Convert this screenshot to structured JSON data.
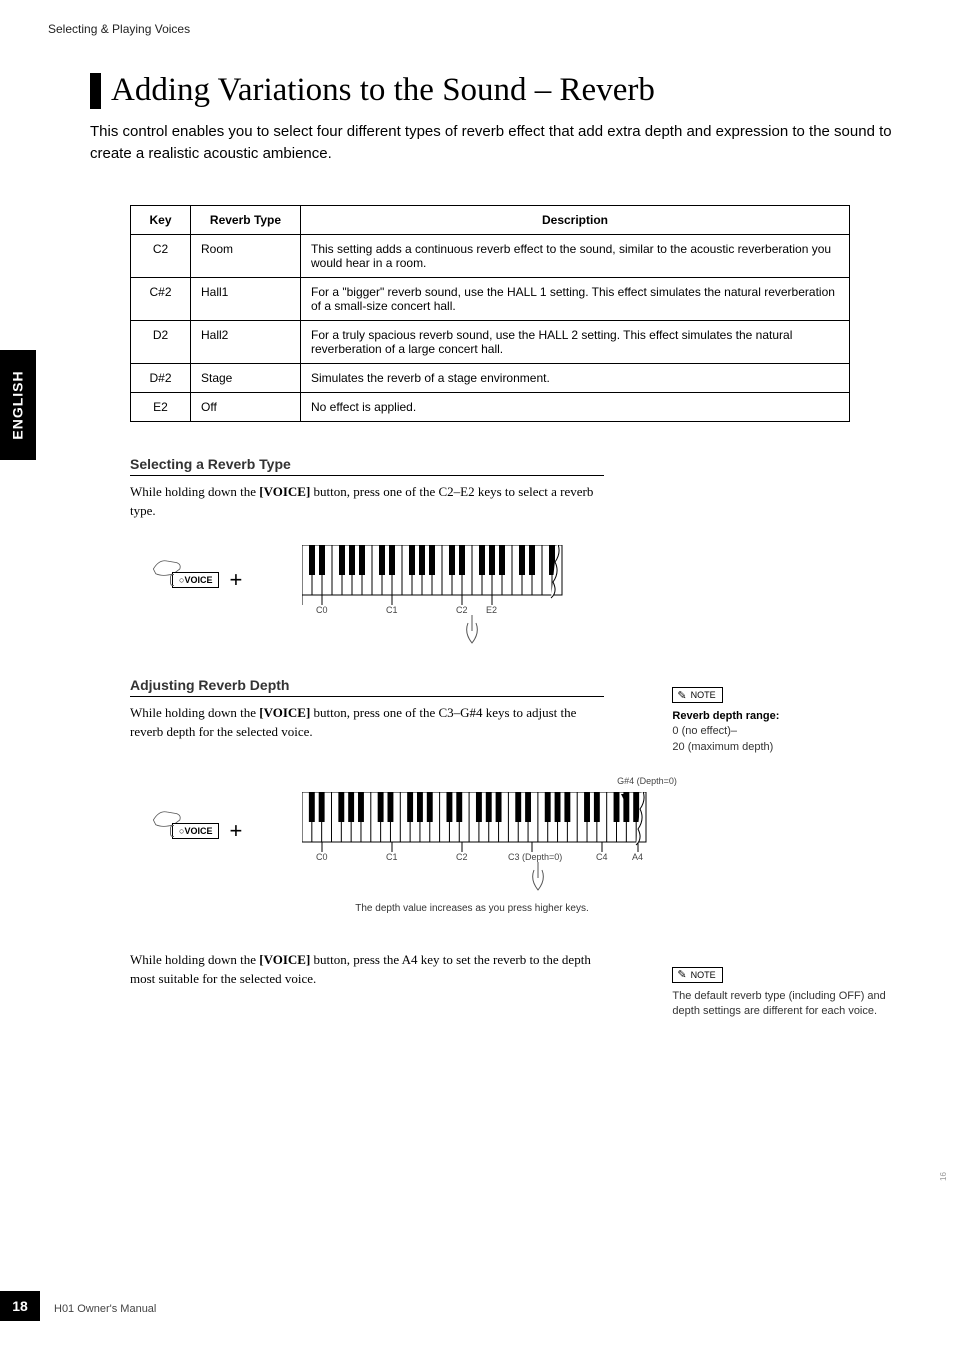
{
  "breadcrumb": "Selecting & Playing Voices",
  "sideTab": "ENGLISH",
  "title": "Adding Variations to the Sound – Reverb",
  "intro": "This control enables you to select four different types of reverb effect that add extra depth and expression to the sound to create a realistic acoustic ambience.",
  "table": {
    "headers": {
      "key": "Key",
      "type": "Reverb Type",
      "desc": "Description"
    },
    "rows": [
      {
        "key": "C2",
        "type": "Room",
        "desc": "This setting adds a continuous reverb effect to the sound, similar to the acoustic reverberation you would hear in a room."
      },
      {
        "key": "C#2",
        "type": "Hall1",
        "desc": "For a \"bigger\" reverb sound, use the HALL 1 setting. This effect simulates the natural reverberation of a small-size concert hall."
      },
      {
        "key": "D2",
        "type": "Hall2",
        "desc": "For a truly spacious reverb sound, use the HALL 2 setting. This effect simulates the natural reverberation of a large concert hall."
      },
      {
        "key": "D#2",
        "type": "Stage",
        "desc": "Simulates the reverb of a stage environment."
      },
      {
        "key": "E2",
        "type": "Off",
        "desc": "No effect is applied."
      }
    ]
  },
  "section1": {
    "heading": "Selecting a Reverb Type",
    "text_pre": "While holding down the ",
    "text_btn": "[VOICE]",
    "text_post": " button, press one of the C2–E2 keys to select a reverb type.",
    "voiceLabel": "VOICE",
    "plus": "+",
    "kb": {
      "c0": "C0",
      "c1": "C1",
      "c2": "C2",
      "e2": "E2"
    }
  },
  "section2": {
    "heading": "Adjusting Reverb Depth",
    "text_pre": "While holding down the ",
    "text_btn": "[VOICE]",
    "text_post": " button, press one of the C3–G#4 keys to adjust the reverb depth for the selected voice.",
    "voiceLabel": "VOICE",
    "plus": "+",
    "kb": {
      "c0": "C0",
      "c1": "C1",
      "c2": "C2",
      "c3": "C3 (Depth=0)",
      "c4": "C4",
      "a4": "A4",
      "g4": "G#4 (Depth=0)"
    },
    "caption": "The depth value increases as you press higher keys.",
    "note": {
      "label": "NOTE",
      "title": "Reverb depth range:",
      "range1": "0 (no effect)–",
      "range2": "20 (maximum depth)"
    }
  },
  "section3": {
    "text_pre": "While holding down the ",
    "text_btn": "[VOICE]",
    "text_post": " button, press the A4 key to set the reverb to the depth most suitable for the selected voice.",
    "note": {
      "label": "NOTE",
      "text": "The default reverb type (including OFF) and depth settings are different for each voice."
    }
  },
  "footer": {
    "page": "18",
    "manual": "H01 Owner's Manual"
  },
  "gutter": "16"
}
